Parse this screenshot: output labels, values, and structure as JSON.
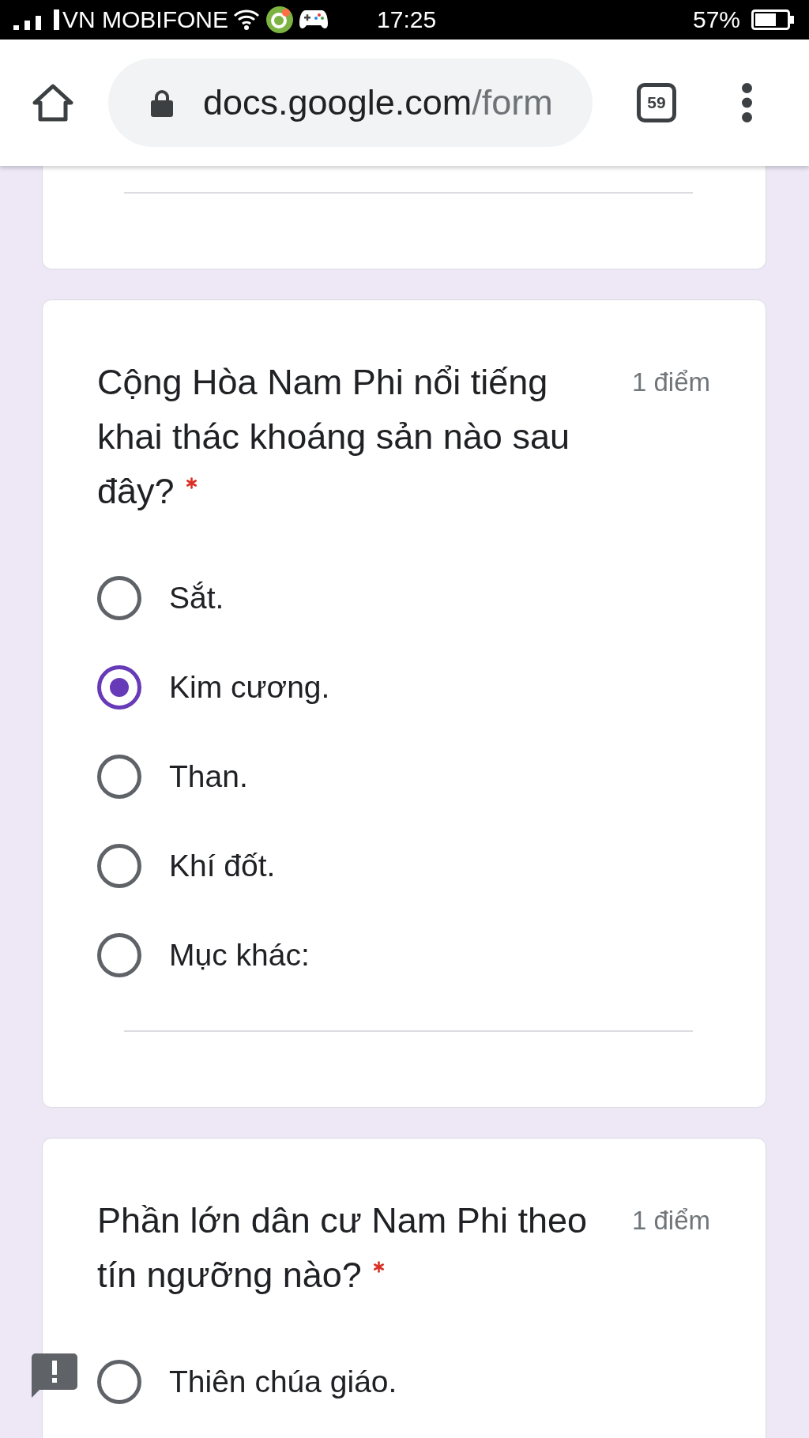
{
  "status_bar": {
    "carrier": "VN MOBIFONE",
    "time": "17:25",
    "battery": "57%"
  },
  "browser": {
    "url_host": "docs.google.com",
    "url_path": "/form",
    "tab_count": "59"
  },
  "cards": [
    {
      "kind": "cut_off",
      "other_answer_field": true
    },
    {
      "kind": "question",
      "title": "Cộng Hòa Nam Phi nổi tiếng khai thác khoáng sản nào sau đây?",
      "required": true,
      "points": "1 điểm",
      "options": [
        {
          "kind": "choice",
          "label": "Sắt.",
          "selected": false
        },
        {
          "kind": "choice",
          "label": "Kim cương.",
          "selected": true
        },
        {
          "kind": "choice",
          "label": "Than.",
          "selected": false
        },
        {
          "kind": "choice",
          "label": "Khí đốt.",
          "selected": false
        },
        {
          "kind": "other",
          "label": "Mục khác:",
          "selected": false
        }
      ]
    },
    {
      "kind": "question",
      "title": "Phần lớn dân cư Nam Phi theo tín ngưỡng nào?",
      "required": true,
      "points": "1 điểm",
      "options": [
        {
          "kind": "choice",
          "label": "Thiên chúa giáo.",
          "selected": false
        }
      ]
    }
  ]
}
